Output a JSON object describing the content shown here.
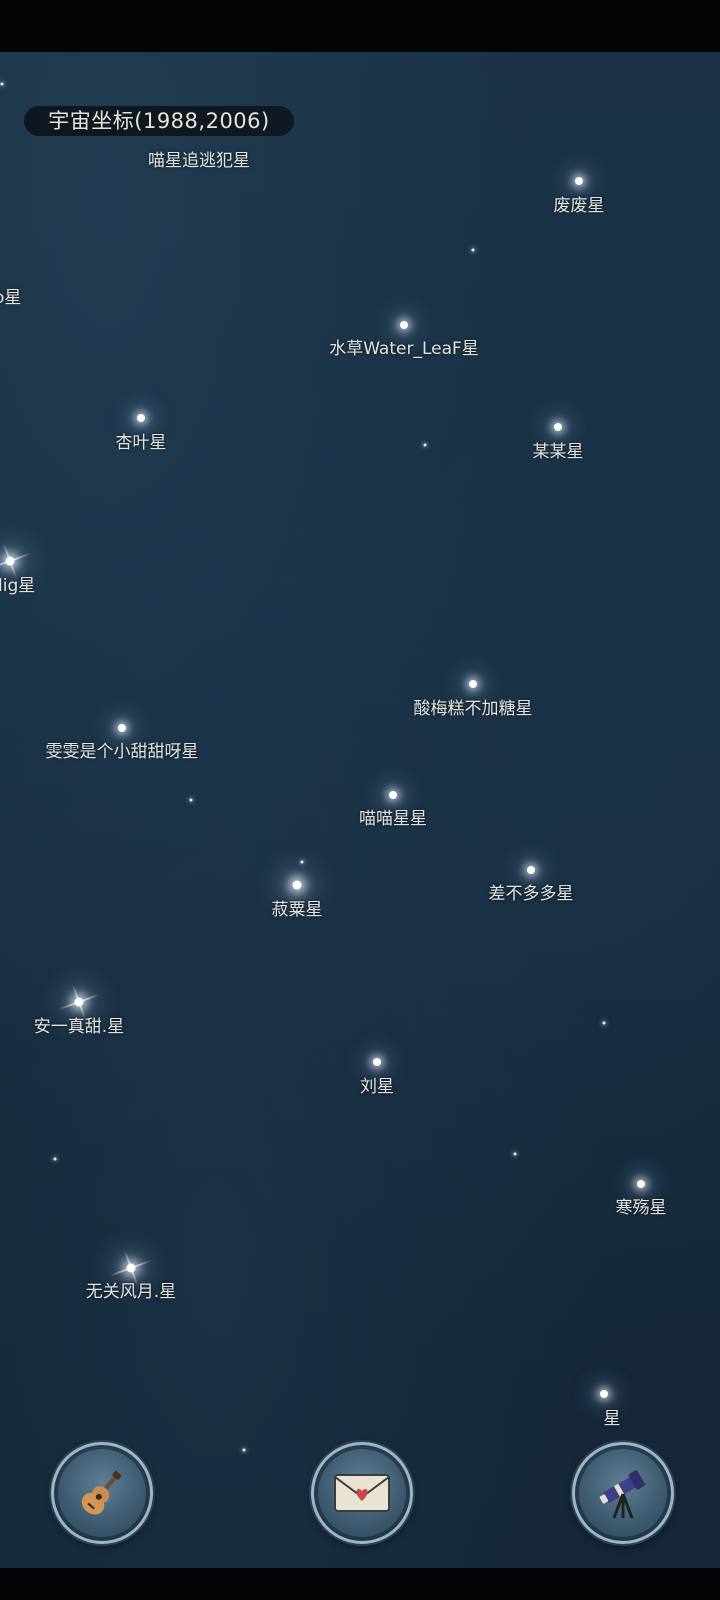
{
  "header": {
    "coordinates_text": "宇宙坐标(1988,2006)"
  },
  "stars": [
    {
      "id": "s1",
      "label": "喵星追逃犯星"
    },
    {
      "id": "s2",
      "label": "废废星"
    },
    {
      "id": "s3",
      "label": "o星"
    },
    {
      "id": "s4",
      "label": "水草Water_LeaF星"
    },
    {
      "id": "s5",
      "label": "杏叶星"
    },
    {
      "id": "s6",
      "label": "某某星"
    },
    {
      "id": "s7",
      "label": "lig星"
    },
    {
      "id": "s8",
      "label": "酸梅糕不加糖星"
    },
    {
      "id": "s9",
      "label": "雯雯是个小甜甜呀星"
    },
    {
      "id": "s10",
      "label": "喵喵星星"
    },
    {
      "id": "s11",
      "label": "菽粟星"
    },
    {
      "id": "s12",
      "label": "差不多多星"
    },
    {
      "id": "s13",
      "label": "安一真甜.星"
    },
    {
      "id": "s14",
      "label": "刘星"
    },
    {
      "id": "s15",
      "label": "寒殇星"
    },
    {
      "id": "s16",
      "label": "无关风月.星"
    },
    {
      "id": "s17",
      "label": "星"
    }
  ],
  "bottom_nav": {
    "left_icon": "guitar-icon",
    "center_icon": "envelope-heart-icon",
    "right_icon": "telescope-icon"
  },
  "colors": {
    "sky_dark": "#152638",
    "sky_light": "#1b3246",
    "label_text": "#e4e2dc",
    "button_ring": "#9fb6c4"
  }
}
